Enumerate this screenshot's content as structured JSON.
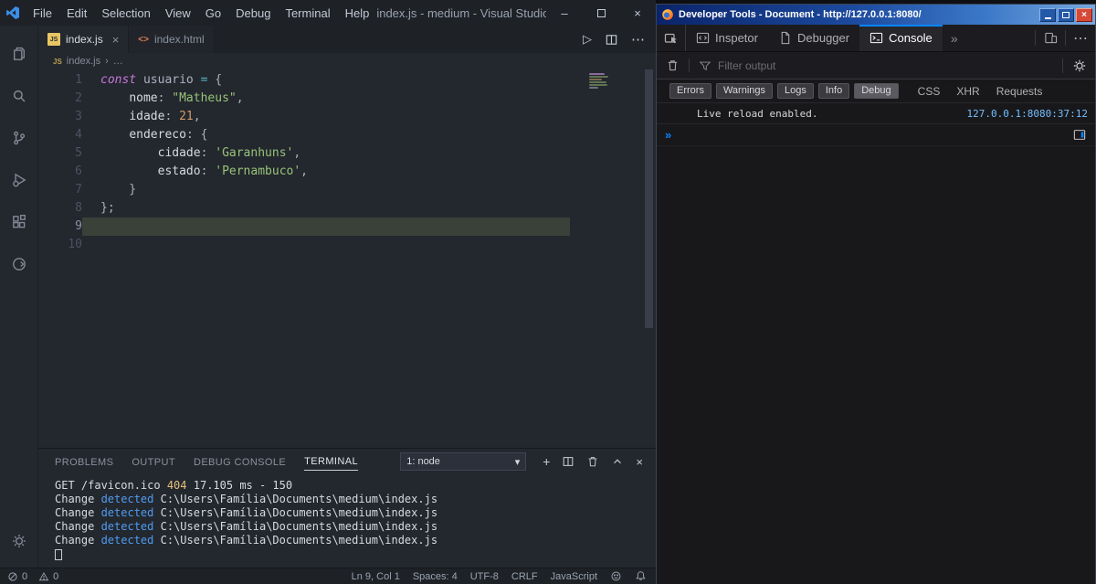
{
  "vscode": {
    "titlebar": {
      "menus": [
        "File",
        "Edit",
        "Selection",
        "View",
        "Go",
        "Debug",
        "Terminal",
        "Help"
      ],
      "title": "index.js - medium - Visual Studio Code",
      "minimize_glyph": "–",
      "close_glyph": "×"
    },
    "tabs": {
      "active": {
        "label": "index.js",
        "badge": "JS",
        "close_glyph": "×"
      },
      "inactive": {
        "label": "index.html",
        "badge": "<>"
      }
    },
    "editor_actions": {
      "run_glyph": "▷",
      "more_glyph": "⋯"
    },
    "breadcrumb": {
      "file": "index.js",
      "badge": "JS",
      "separator": "›",
      "more": "…"
    },
    "editor": {
      "lines": [
        {
          "num": "1",
          "segments": [
            {
              "t": "const ",
              "c": "kw"
            },
            {
              "t": "usuario ",
              "c": "plain"
            },
            {
              "t": "= ",
              "c": "op"
            },
            {
              "t": "{",
              "c": "plain"
            }
          ]
        },
        {
          "num": "2",
          "segments": [
            {
              "t": "    ",
              "c": "plain"
            },
            {
              "t": "nome",
              "c": "prop"
            },
            {
              "t": ": ",
              "c": "plain"
            },
            {
              "t": "\"Matheus\"",
              "c": "str"
            },
            {
              "t": ",",
              "c": "plain"
            }
          ]
        },
        {
          "num": "3",
          "segments": [
            {
              "t": "    ",
              "c": "plain"
            },
            {
              "t": "idade",
              "c": "prop"
            },
            {
              "t": ": ",
              "c": "plain"
            },
            {
              "t": "21",
              "c": "num"
            },
            {
              "t": ",",
              "c": "plain"
            }
          ]
        },
        {
          "num": "4",
          "segments": [
            {
              "t": "    ",
              "c": "plain"
            },
            {
              "t": "endereco",
              "c": "prop"
            },
            {
              "t": ": ",
              "c": "plain"
            },
            {
              "t": "{",
              "c": "plain"
            }
          ]
        },
        {
          "num": "5",
          "segments": [
            {
              "t": "        ",
              "c": "plain"
            },
            {
              "t": "cidade",
              "c": "prop"
            },
            {
              "t": ": ",
              "c": "plain"
            },
            {
              "t": "'Garanhuns'",
              "c": "str"
            },
            {
              "t": ",",
              "c": "plain"
            }
          ]
        },
        {
          "num": "6",
          "segments": [
            {
              "t": "        ",
              "c": "plain"
            },
            {
              "t": "estado",
              "c": "prop"
            },
            {
              "t": ": ",
              "c": "plain"
            },
            {
              "t": "'Pernambuco'",
              "c": "str"
            },
            {
              "t": ",",
              "c": "plain"
            }
          ]
        },
        {
          "num": "7",
          "segments": [
            {
              "t": "    }",
              "c": "plain"
            }
          ]
        },
        {
          "num": "8",
          "segments": [
            {
              "t": "};",
              "c": "plain"
            }
          ]
        },
        {
          "num": "9",
          "active": true,
          "segments": []
        },
        {
          "num": "10",
          "segments": []
        }
      ]
    },
    "panel": {
      "tabs": [
        "PROBLEMS",
        "OUTPUT",
        "DEBUG CONSOLE",
        "TERMINAL"
      ],
      "shell_select": "1: node",
      "select_chevron": "▾",
      "plus_glyph": "+",
      "close_glyph": "×",
      "terminal_lines": [
        {
          "segments": [
            {
              "t": "GET /favicon.ico ",
              "c": "fg"
            },
            {
              "t": "404",
              "c": "yellow"
            },
            {
              "t": " 17.105 ms - 150",
              "c": "fg"
            }
          ]
        },
        {
          "segments": [
            {
              "t": "Change ",
              "c": "fg"
            },
            {
              "t": "detected ",
              "c": "blue"
            },
            {
              "t": "C:\\Users\\Família\\Documents\\medium\\index.js",
              "c": "fg"
            }
          ]
        },
        {
          "segments": [
            {
              "t": "Change ",
              "c": "fg"
            },
            {
              "t": "detected ",
              "c": "blue"
            },
            {
              "t": "C:\\Users\\Família\\Documents\\medium\\index.js",
              "c": "fg"
            }
          ]
        },
        {
          "segments": [
            {
              "t": "Change ",
              "c": "fg"
            },
            {
              "t": "detected ",
              "c": "blue"
            },
            {
              "t": "C:\\Users\\Família\\Documents\\medium\\index.js",
              "c": "fg"
            }
          ]
        },
        {
          "segments": [
            {
              "t": "Change ",
              "c": "fg"
            },
            {
              "t": "detected ",
              "c": "blue"
            },
            {
              "t": "C:\\Users\\Família\\Documents\\medium\\index.js",
              "c": "fg"
            }
          ]
        }
      ]
    },
    "statusbar": {
      "errors": "0",
      "warnings": "0",
      "cursor_position": "Ln 9, Col 1",
      "indentation": "Spaces: 4",
      "encoding": "UTF-8",
      "eol": "CRLF",
      "language": "JavaScript"
    }
  },
  "devtools": {
    "titlebar": {
      "title": "Developer Tools - Document - http://127.0.0.1:8080/",
      "close_glyph": "×"
    },
    "tabs": {
      "inspector": "Inspetor",
      "debugger": "Debugger",
      "console": "Console",
      "overflow_glyph": "»",
      "more_glyph": "⋯"
    },
    "filterbar": {
      "placeholder": "Filter output"
    },
    "level_filters": [
      "Errors",
      "Warnings",
      "Logs",
      "Info",
      "Debug"
    ],
    "category_filters": [
      "CSS",
      "XHR",
      "Requests"
    ],
    "console": {
      "message": "Live reload enabled.",
      "source_link": "127.0.0.1:8080:37:12",
      "input_chevron": "»"
    },
    "colors": {
      "accent": "#0a84ff",
      "link": "#75bfff"
    }
  }
}
